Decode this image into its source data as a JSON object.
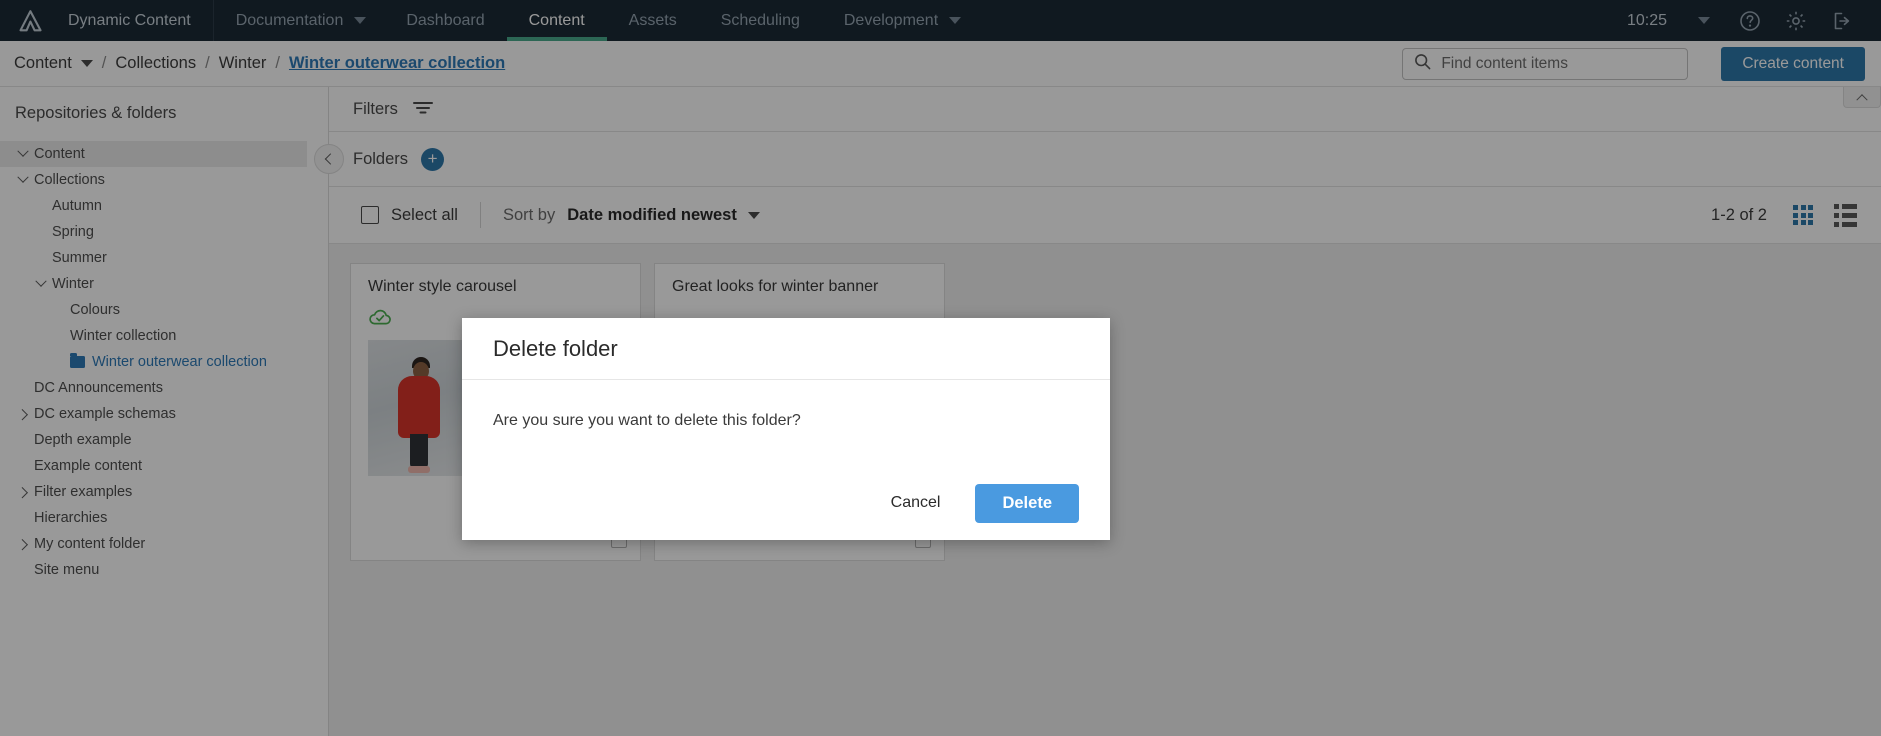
{
  "topnav": {
    "logo_icon": "amplience-logo-icon",
    "brand": "Dynamic Content",
    "items": [
      {
        "label": "Documentation",
        "active": false,
        "caret": true
      },
      {
        "label": "Dashboard",
        "active": false,
        "caret": false
      },
      {
        "label": "Content",
        "active": true,
        "caret": false
      },
      {
        "label": "Assets",
        "active": false,
        "caret": false
      },
      {
        "label": "Scheduling",
        "active": false,
        "caret": false
      },
      {
        "label": "Development",
        "active": false,
        "caret": true
      }
    ],
    "clock": "10:25",
    "help_icon": "help-circle-icon",
    "settings_icon": "gear-icon",
    "signout_icon": "sign-out-icon",
    "accent_active": "#4aab8c",
    "background": "#1b2a36"
  },
  "breadcrumb": {
    "root": "Content",
    "sep": "/",
    "items": [
      "Collections",
      "Winter"
    ],
    "current": "Winter outerwear collection",
    "current_color": "#2e7ab8"
  },
  "search": {
    "placeholder": "Find content items",
    "value": "",
    "icon": "search-icon"
  },
  "create_button": {
    "label": "Create content",
    "color": "#2e78ab"
  },
  "sidebar": {
    "title": "Repositories & folders",
    "tree": [
      {
        "label": "Content",
        "depth": 0,
        "toggle": "down",
        "highlight": true
      },
      {
        "label": "Collections",
        "depth": 0,
        "toggle": "down"
      },
      {
        "label": "Autumn",
        "depth": 1,
        "toggle": "none"
      },
      {
        "label": "Spring",
        "depth": 1,
        "toggle": "none"
      },
      {
        "label": "Summer",
        "depth": 1,
        "toggle": "none"
      },
      {
        "label": "Winter",
        "depth": 1,
        "toggle": "down"
      },
      {
        "label": "Colours",
        "depth": 2,
        "toggle": "none"
      },
      {
        "label": "Winter collection",
        "depth": 2,
        "toggle": "none"
      },
      {
        "label": "Winter outerwear collection",
        "depth": 2,
        "toggle": "none",
        "selected": true,
        "folder_icon": true
      },
      {
        "label": "DC Announcements",
        "depth": 0,
        "toggle": "none"
      },
      {
        "label": "DC example schemas",
        "depth": 0,
        "toggle": "right"
      },
      {
        "label": "Depth example",
        "depth": 0,
        "toggle": "none"
      },
      {
        "label": "Example content",
        "depth": 0,
        "toggle": "none"
      },
      {
        "label": "Filter examples",
        "depth": 0,
        "toggle": "right"
      },
      {
        "label": "Hierarchies",
        "depth": 0,
        "toggle": "none"
      },
      {
        "label": "My content folder",
        "depth": 0,
        "toggle": "right"
      },
      {
        "label": "Site menu",
        "depth": 0,
        "toggle": "none"
      }
    ]
  },
  "toolbar": {
    "filters_label": "Filters",
    "filters_icon": "filter-icon",
    "folders_label": "Folders",
    "add_folder_icon": "plus-icon",
    "collapse_icon": "chevron-left-icon",
    "select_all_label": "Select all",
    "sort_by_label": "Sort by",
    "sort_value": "Date modified newest",
    "sort_caret_icon": "chevron-down-icon",
    "pager": "1-2 of 2",
    "grid_view_icon": "grid-view-icon",
    "list_view_icon": "list-view-icon",
    "scroll_top_icon": "chevron-up-icon"
  },
  "cards": [
    {
      "title": "Winter style carousel",
      "status_icon": "published-cloud-check-icon",
      "has_thumb": true,
      "checked": false
    },
    {
      "title": "Great looks for winter banner",
      "status_icon": "",
      "has_thumb": false,
      "checked": false
    }
  ],
  "modal": {
    "title": "Delete folder",
    "message": "Are you sure you want to delete this folder?",
    "cancel_label": "Cancel",
    "confirm_label": "Delete",
    "confirm_color": "#4a9ae0"
  }
}
